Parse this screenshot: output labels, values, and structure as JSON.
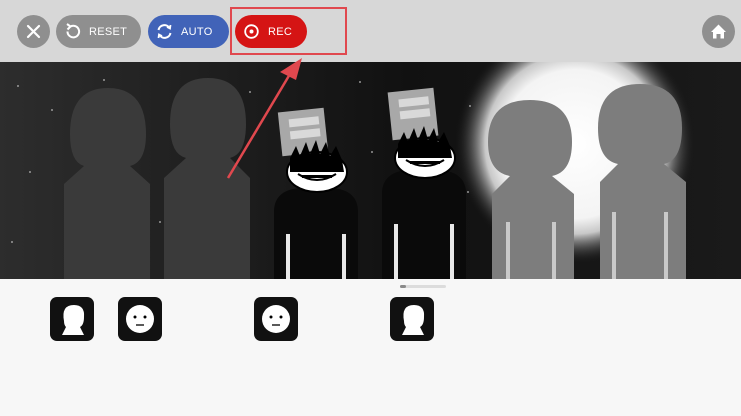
{
  "toolbar": {
    "close_icon": "close-icon",
    "reset_label": "RESET",
    "auto_label": "AUTO",
    "rec_label": "REC",
    "home_icon": "home-icon"
  },
  "stage": {
    "characters": [
      {
        "state": "inactive-silhouette"
      },
      {
        "state": "inactive-silhouette"
      },
      {
        "state": "active-singer"
      },
      {
        "state": "active-singer"
      },
      {
        "state": "inactive-silhouette"
      },
      {
        "state": "inactive-silhouette"
      }
    ]
  },
  "tray": {
    "icons": [
      {
        "kind": "silhouette-head-icon"
      },
      {
        "kind": "face-icon"
      },
      {
        "kind": "face-icon"
      },
      {
        "kind": "silhouette-head-icon"
      }
    ]
  },
  "colors": {
    "rec": "#d51414",
    "auto": "#4163b8",
    "toolbar": "#d7d7d7",
    "button": "#8f8f8f"
  }
}
